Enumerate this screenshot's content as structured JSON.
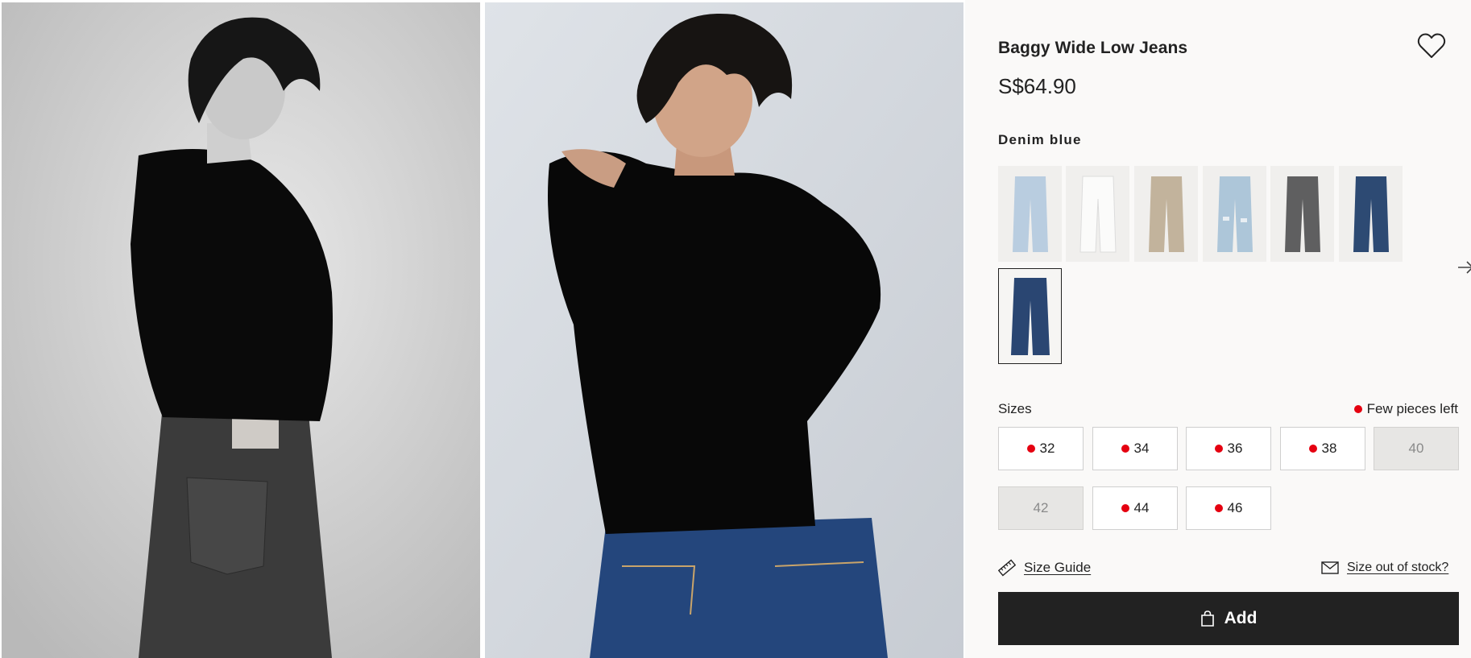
{
  "gallery": {
    "images": [
      {
        "alt": "Model in black long-sleeve top and dark baggy jeans, black and white photo"
      },
      {
        "alt": "Model in black long-sleeve top and blue jeans, colour photo"
      }
    ]
  },
  "product": {
    "title": "Baggy Wide Low Jeans",
    "price": "S$64.90",
    "color_name": "Denim blue",
    "favorite_icon": "heart-outline-icon"
  },
  "swatches": [
    {
      "label": "Light denim blue",
      "color": "#b9cde0"
    },
    {
      "label": "White",
      "color": "#f2f2f0"
    },
    {
      "label": "Beige",
      "color": "#c2b39c"
    },
    {
      "label": "Light denim blue ripped",
      "color": "#adc6d9"
    },
    {
      "label": "Washed grey",
      "color": "#5f5f60"
    },
    {
      "label": "Dark denim blue",
      "color": "#2d4a73"
    },
    {
      "label": "Denim blue",
      "color": "#2a4672",
      "selected": true
    }
  ],
  "sizes": {
    "label": "Sizes",
    "few_left_label": "Few pieces left",
    "options": [
      {
        "label": "32",
        "few_left": true,
        "available": true
      },
      {
        "label": "34",
        "few_left": true,
        "available": true
      },
      {
        "label": "36",
        "few_left": true,
        "available": true
      },
      {
        "label": "38",
        "few_left": true,
        "available": true
      },
      {
        "label": "40",
        "few_left": false,
        "available": false
      },
      {
        "label": "42",
        "few_left": false,
        "available": false
      },
      {
        "label": "44",
        "few_left": true,
        "available": true
      },
      {
        "label": "46",
        "few_left": true,
        "available": true
      }
    ]
  },
  "links": {
    "size_guide": "Size Guide",
    "size_out_of_stock": "Size out of stock?"
  },
  "cart": {
    "add_label": "Add",
    "icon": "shopping-bag-icon"
  },
  "colors": {
    "accent": "#222222",
    "stock_dot": "#e50010",
    "panel_bg": "#faf9f8"
  }
}
